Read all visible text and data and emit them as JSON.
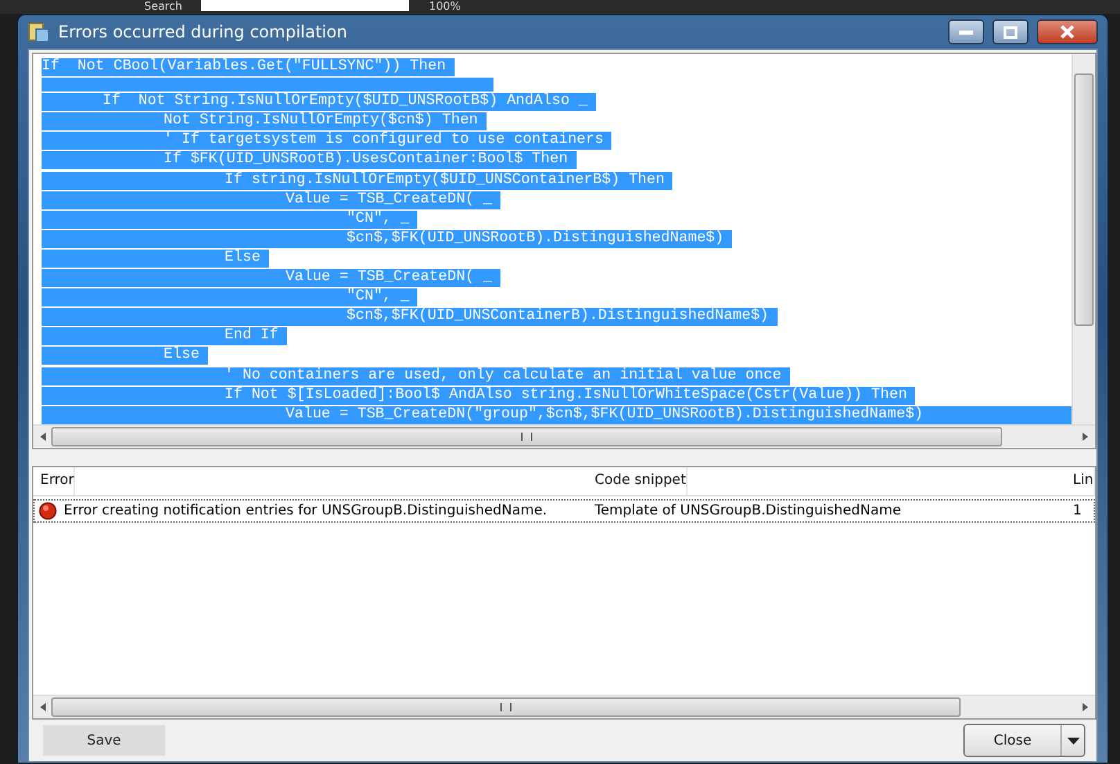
{
  "background": {
    "search_label": "Search",
    "zoom": "100%"
  },
  "window": {
    "title": "Errors occurred during compilation"
  },
  "code": {
    "lines": [
      {
        "kind": "text",
        "text": "If  Not CBool(Variables.Get(\"FULLSYNC\")) Then"
      },
      {
        "kind": "blank"
      },
      {
        "kind": "text",
        "text": "\tIf  Not String.IsNullOrEmpty($UID_UNSRootB$) AndAlso _"
      },
      {
        "kind": "text",
        "text": "\t\tNot String.IsNullOrEmpty($cn$) Then"
      },
      {
        "kind": "text",
        "text": "\t\t' If targetsystem is configured to use containers"
      },
      {
        "kind": "text",
        "text": "\t\tIf $FK(UID_UNSRootB).UsesContainer:Bool$ Then"
      },
      {
        "kind": "text",
        "text": "\t\t\tIf string.IsNullOrEmpty($UID_UNSContainerB$) Then"
      },
      {
        "kind": "text",
        "text": "\t\t\t\tValue = TSB_CreateDN( _"
      },
      {
        "kind": "text",
        "text": "\t\t\t\t\t\"CN\", _"
      },
      {
        "kind": "text",
        "text": "\t\t\t\t\t$cn$,$FK(UID_UNSRootB).DistinguishedName$)"
      },
      {
        "kind": "text",
        "text": "\t\t\tElse"
      },
      {
        "kind": "text",
        "text": "\t\t\t\tValue = TSB_CreateDN( _"
      },
      {
        "kind": "text",
        "text": "\t\t\t\t\t\"CN\", _"
      },
      {
        "kind": "text",
        "text": "\t\t\t\t\t$cn$,$FK(UID_UNSContainerB).DistinguishedName$)"
      },
      {
        "kind": "text",
        "text": "\t\t\tEnd If"
      },
      {
        "kind": "text",
        "text": "\t\tElse"
      },
      {
        "kind": "text",
        "text": "\t\t\t' No containers are used, only calculate an initial value once"
      },
      {
        "kind": "text",
        "text": "\t\t\tIf Not $[IsLoaded]:Bool$ AndAlso string.IsNullOrWhiteSpace(Cstr(Value)) Then"
      },
      {
        "kind": "text",
        "text": "\t\t\t\tValue = TSB_CreateDN(\"group\",$cn$,$FK(UID_UNSRootB).DistinguishedName$)"
      }
    ]
  },
  "errors": {
    "columns": [
      "Error",
      "Code snippet",
      "Lin"
    ],
    "rows": [
      {
        "kind": "error",
        "selected": true,
        "cells": [
          "Error creating notification entries for UNSGroupB.DistinguishedName.",
          "Template of UNSGroupB.DistinguishedName",
          "1"
        ]
      }
    ]
  },
  "buttons": {
    "save": "Save",
    "close": "Close"
  }
}
